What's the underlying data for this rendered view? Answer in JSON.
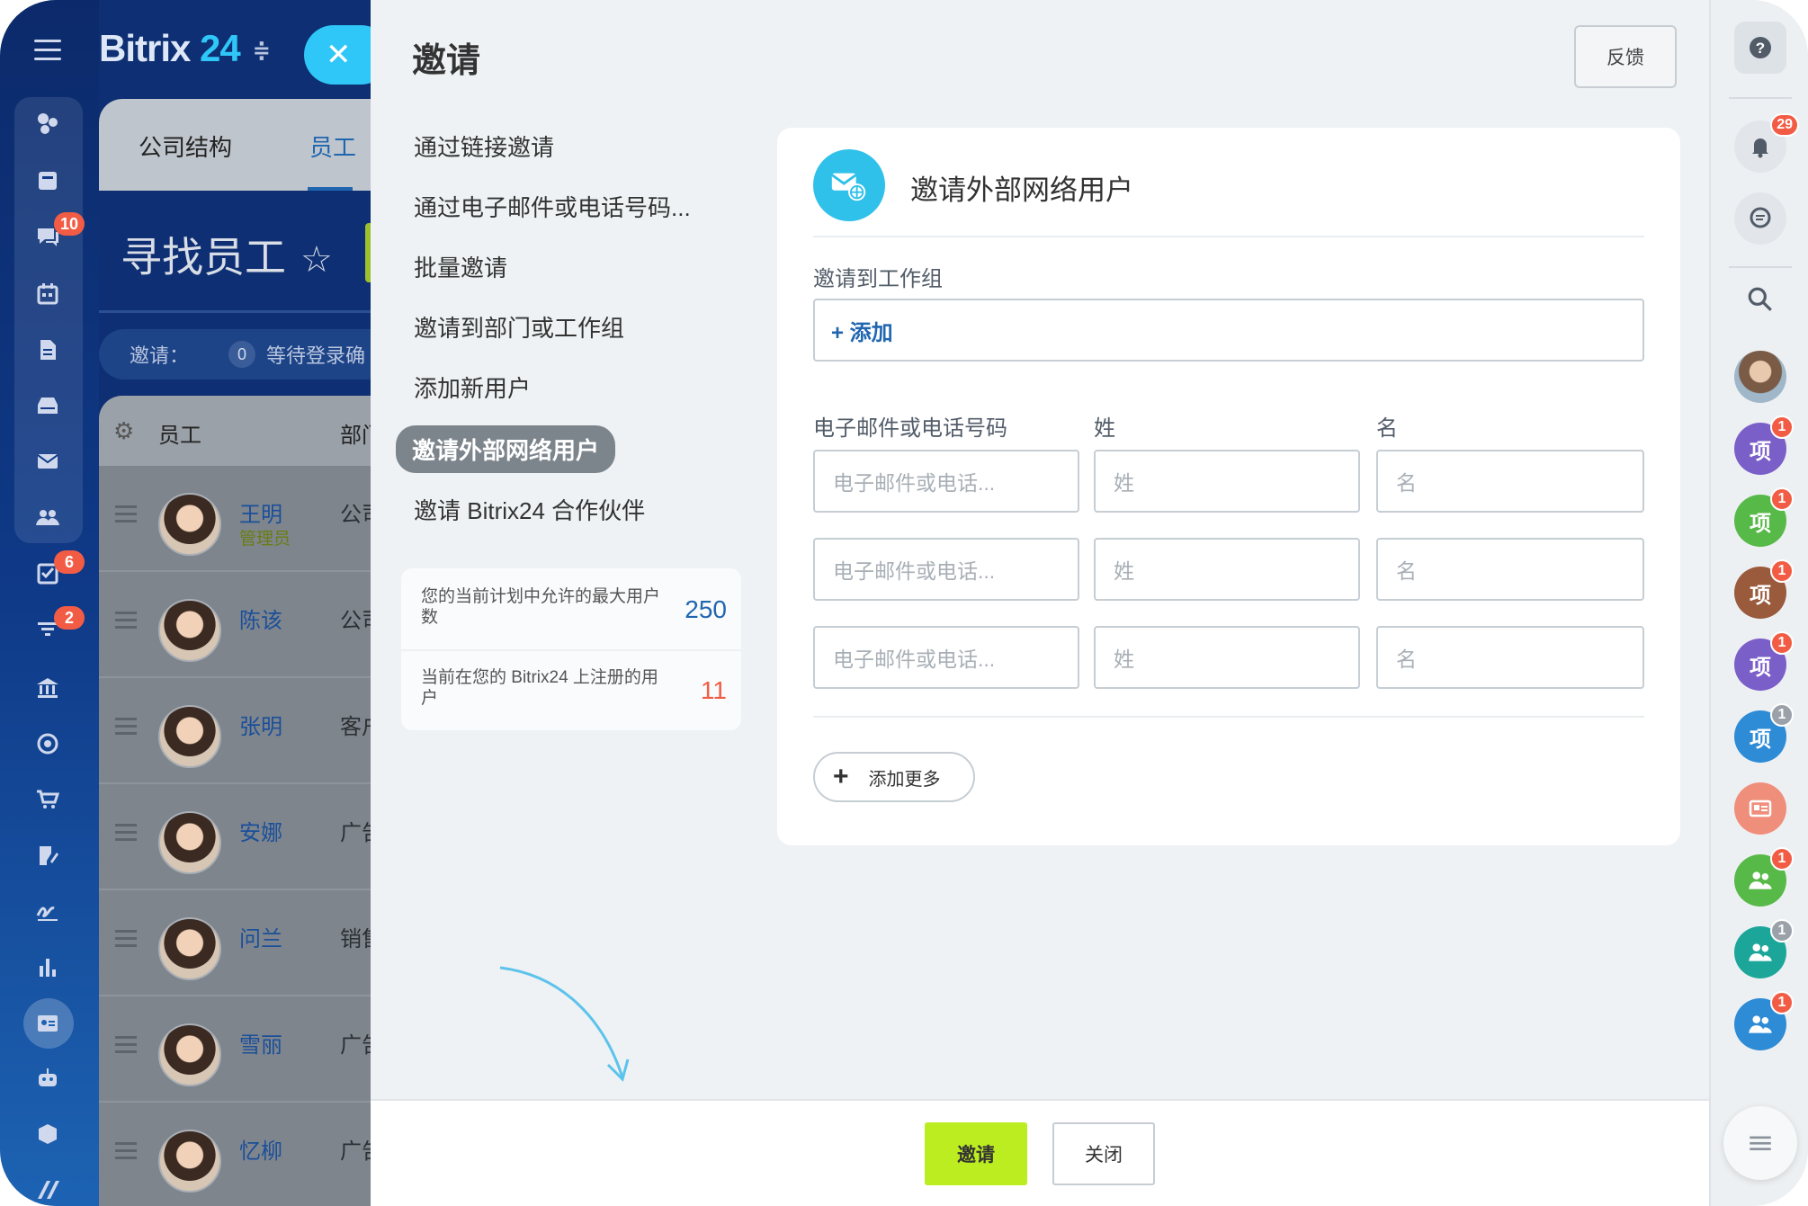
{
  "brand": {
    "name": "Bitrix",
    "number": "24"
  },
  "left_rail": {
    "badges": {
      "chat": "10",
      "tasks": "6",
      "filters": "2"
    }
  },
  "backdrop": {
    "tabs": [
      "公司结构",
      "员工"
    ],
    "search_title": "寻找员工",
    "invite_label": "邀请：",
    "invite_count": "0",
    "invite_status": "等待登录确",
    "columns": [
      "员工",
      "部门"
    ],
    "rows": [
      {
        "name": "王明",
        "role": "管理员",
        "dept": "公司"
      },
      {
        "name": "陈该",
        "role": "",
        "dept": "公司"
      },
      {
        "name": "张明",
        "role": "",
        "dept": "客户"
      },
      {
        "name": "安娜",
        "role": "",
        "dept": "广告"
      },
      {
        "name": "问兰",
        "role": "",
        "dept": "销售"
      },
      {
        "name": "雪丽",
        "role": "",
        "dept": "广告"
      },
      {
        "name": "忆柳",
        "role": "",
        "dept": "广告"
      }
    ]
  },
  "slider": {
    "title": "邀请",
    "feedback": "反馈",
    "menu": [
      "通过链接邀请",
      "通过电子邮件或电话号码...",
      "批量邀请",
      "邀请到部门或工作组",
      "添加新用户",
      "邀请外部网络用户",
      "邀请 Bitrix24 合作伙伴"
    ],
    "active_menu_index": 5,
    "quota": {
      "max_label": "您的当前计划中允许的最大用户数",
      "max_value": "250",
      "registered_label": "当前在您的 Bitrix24 上注册的用户",
      "registered_value": "11"
    },
    "card": {
      "title": "邀请外部网络用户",
      "group_label": "邀请到工作组",
      "add_label": "+ 添加",
      "col_email": "电子邮件或电话号码",
      "col_last": "姓",
      "col_first": "名",
      "placeholder_email": "电子邮件或电话...",
      "placeholder_last": "姓",
      "placeholder_first": "名",
      "add_more": "添加更多"
    },
    "footer": {
      "invite": "邀请",
      "close": "关闭"
    }
  },
  "right_rail": {
    "notif_count": "29",
    "project_label": "项",
    "items": [
      {
        "type": "project",
        "color": "#7b5fc9",
        "badge": "1",
        "badge_color": "#f25c45"
      },
      {
        "type": "project",
        "color": "#57b947",
        "badge": "1",
        "badge_color": "#f25c45"
      },
      {
        "type": "project",
        "color": "#9a5a3c",
        "badge": "1",
        "badge_color": "#f25c45"
      },
      {
        "type": "project",
        "color": "#7b5fc9",
        "badge": "1",
        "badge_color": "#f25c45"
      },
      {
        "type": "project",
        "color": "#2e8bd6",
        "badge": "1",
        "badge_color": "#9aa1a8"
      },
      {
        "type": "card",
        "color": "#f08e7c",
        "badge": "",
        "badge_color": ""
      },
      {
        "type": "group",
        "color": "#57b947",
        "badge": "1",
        "badge_color": "#f25c45"
      },
      {
        "type": "group",
        "color": "#1ca69a",
        "badge": "1",
        "badge_color": "#9aa1a8"
      },
      {
        "type": "group",
        "color": "#2e8bd6",
        "badge": "1",
        "badge_color": "#f25c45"
      }
    ]
  }
}
